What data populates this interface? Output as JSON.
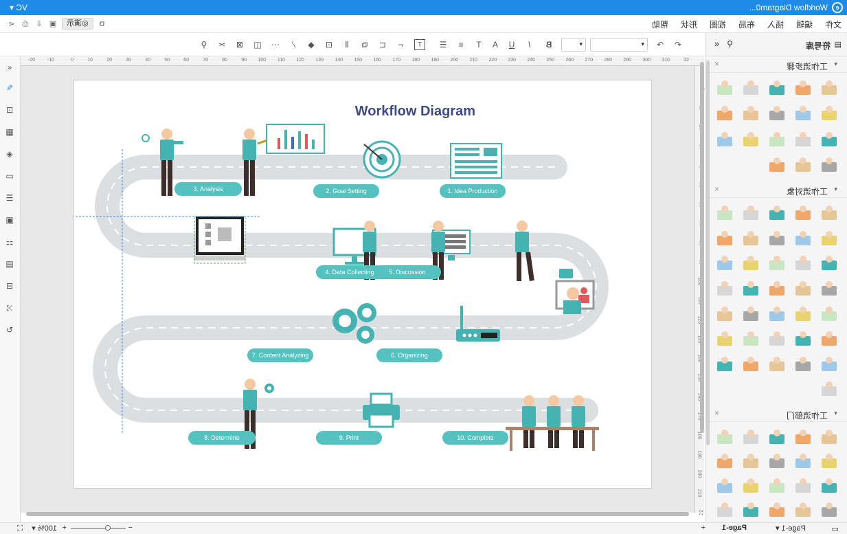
{
  "app": {
    "window_title": "Workflow Diagram0...",
    "user_label": "VC",
    "user_caret": "▾"
  },
  "menu": {
    "items": [
      "文件",
      "编辑",
      "插入",
      "布局",
      "视图",
      "形状",
      "帮助"
    ],
    "present_label": "演示"
  },
  "library": {
    "title": "符号库",
    "categories": [
      "工作流步骤",
      "工作流对象",
      "工作流部门"
    ]
  },
  "toolbar": {
    "font_placeholder": "",
    "size_placeholder": ""
  },
  "ruler": {
    "h_ticks": [
      "-20",
      "-10",
      "0",
      "10",
      "20",
      "30",
      "40",
      "50",
      "60",
      "70",
      "80",
      "90",
      "100",
      "110",
      "120",
      "130",
      "140",
      "150",
      "160",
      "170",
      "180",
      "190",
      "200",
      "210",
      "220",
      "230",
      "240",
      "250",
      "260",
      "270",
      "280",
      "290",
      "300",
      "310",
      "32"
    ],
    "v_ticks": [
      "0",
      "10",
      "20",
      "30",
      "40",
      "50",
      "60",
      "70",
      "80",
      "90",
      "100",
      "110",
      "120",
      "130",
      "140",
      "150",
      "160",
      "170",
      "180",
      "190",
      "200",
      "210",
      "22"
    ]
  },
  "diagram": {
    "title": "Workflow Diagram",
    "steps": [
      "1. Idea Production",
      "2. Goal Setting",
      "3. Analysis",
      "4. Data Collecting",
      "5. Discussion",
      "6. Organizing",
      "7. Content Analyzing",
      "8. Determine",
      "9. Print",
      "10. Complete"
    ]
  },
  "status": {
    "page_label": "Page-1",
    "page_tab": "Page-1",
    "zoom": "100%"
  },
  "colors": {
    "accent": "#1e8ce6",
    "teal": "#55c2c0",
    "road": "#dcdfe2",
    "title_text": "#3f4b86"
  }
}
